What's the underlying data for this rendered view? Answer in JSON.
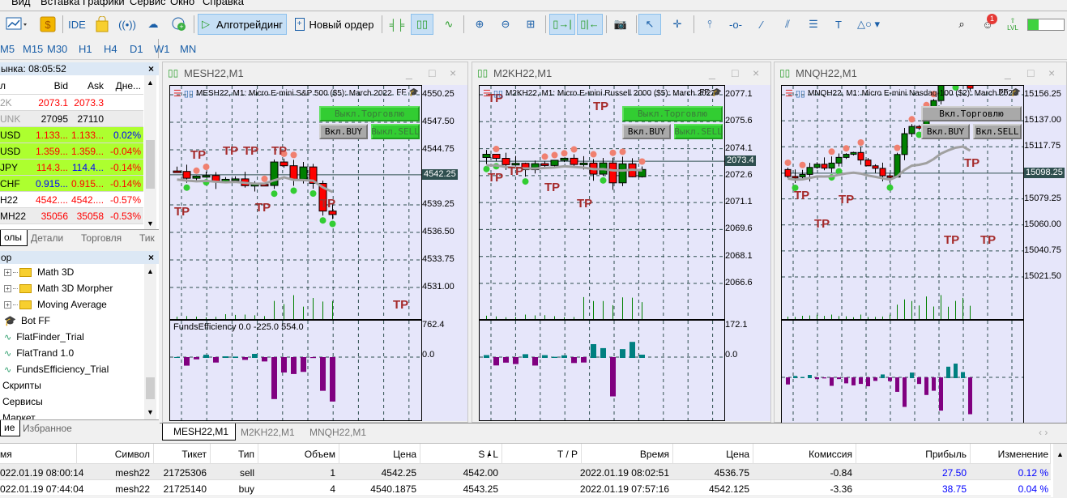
{
  "menu": [
    "Вид",
    "Вставка",
    "Графики",
    "Сервис",
    "Окно",
    "Справка"
  ],
  "toolbar": {
    "ide": "IDE",
    "algo": "Алготрейдинг",
    "new_order": "Новый ордер",
    "notif_count": "1",
    "lvl": "LVL"
  },
  "timeframes": [
    "M5",
    "M15",
    "M30",
    "H1",
    "H4",
    "D1",
    "W1",
    "MN"
  ],
  "market_watch": {
    "title": "ынка: 08:05:52",
    "columns": [
      "л",
      "Bid",
      "Ask",
      "Дне..."
    ],
    "rows": [
      {
        "sym": "2K",
        "bid": "2073.1",
        "ask": "2073.3",
        "chg": "",
        "bg": "#ffffff",
        "c": [
          "#999999",
          "#ff0000",
          "#ff0000",
          "#000000"
        ]
      },
      {
        "sym": "UNK",
        "bid": "27095",
        "ask": "27110",
        "chg": "",
        "bg": "#ececec",
        "c": [
          "#999999",
          "#000000",
          "#000000",
          "#000000"
        ]
      },
      {
        "sym": "USD",
        "bid": "1.133...",
        "ask": "1.133...",
        "chg": "0.02%",
        "bg": "#adff2f",
        "c": [
          "#000000",
          "#ff0000",
          "#ff0000",
          "#0000ff"
        ]
      },
      {
        "sym": "USD",
        "bid": "1.359...",
        "ask": "1.359...",
        "chg": "-0.04%",
        "bg": "#adff2f",
        "c": [
          "#000000",
          "#ff0000",
          "#ff0000",
          "#ff0000"
        ]
      },
      {
        "sym": "JPY",
        "bid": "114.3...",
        "ask": "114.4...",
        "chg": "-0.14%",
        "bg": "#adff2f",
        "c": [
          "#000000",
          "#ff0000",
          "#0000ff",
          "#ff0000"
        ]
      },
      {
        "sym": "CHF",
        "bid": "0.915...",
        "ask": "0.915...",
        "chg": "-0.14%",
        "bg": "#adff2f",
        "c": [
          "#000000",
          "#0000ff",
          "#ff0000",
          "#ff0000"
        ]
      },
      {
        "sym": "H22",
        "bid": "4542....",
        "ask": "4542....",
        "chg": "-0.57%",
        "bg": "#ffffff",
        "c": [
          "#000000",
          "#ff0000",
          "#ff0000",
          "#ff0000"
        ]
      },
      {
        "sym": "МН22",
        "bid": "35056",
        "ask": "35058",
        "chg": "-0.53%",
        "bg": "#ececec",
        "c": [
          "#000000",
          "#ff0000",
          "#ff0000",
          "#ff0000"
        ]
      }
    ],
    "tabs": [
      "олы",
      "Детали",
      "Торговля",
      "Тик"
    ]
  },
  "navigator": {
    "title": "ор",
    "items": [
      {
        "label": "Math 3D",
        "type": "folder"
      },
      {
        "label": "Math 3D Morpher",
        "type": "folder"
      },
      {
        "label": "Moving Average",
        "type": "folder"
      },
      {
        "label": "Bot FF",
        "type": "expert"
      },
      {
        "label": "FlatFinder_Trial",
        "type": "indicator"
      },
      {
        "label": "FlatTrand 1.0",
        "type": "indicator"
      },
      {
        "label": "FundsEfficiency_Trial",
        "type": "indicator"
      },
      {
        "label": "Скрипты",
        "type": "group"
      },
      {
        "label": "Сервисы",
        "type": "group"
      },
      {
        "label": "Маркет",
        "type": "group"
      }
    ],
    "tabs": [
      "ие",
      "Избранное"
    ]
  },
  "charts": [
    {
      "window_title": "MESH22,M1",
      "desc": "MESH22, M1: Micro E-mini S&P 500 ($5): March 2022",
      "ea": "FF",
      "ticks": [
        4550.25,
        4547.5,
        4544.75,
        4539.25,
        4536.5,
        4533.75,
        4531.0
      ],
      "tick_labels": [
        "4550.25",
        "4547.50",
        "4544.75",
        "4539.25",
        "4536.50",
        "4533.75",
        "4531.00"
      ],
      "current": "4542.25",
      "current_value": 4542.25,
      "buttons": [
        {
          "label": "Выкл.Торговлю",
          "state": "on"
        },
        {
          "label": "Вкл.BUY",
          "state": "off"
        },
        {
          "label": "Выкл.SELL",
          "state": "on"
        }
      ],
      "indicator": {
        "label": "FundsEfficiency 0.0 -225.0 554.0",
        "ticks": [
          "762.4",
          "0.0"
        ]
      },
      "tp": "TP",
      "seed": 7
    },
    {
      "window_title": "M2KH22,M1",
      "desc": "M2KH22, M1: Micro E-mini Russell 2000 ($5): March 2022",
      "ea": "FF",
      "ticks": [
        2077.1,
        2075.6,
        2074.1,
        2072.6,
        2071.1,
        2069.6,
        2068.1,
        2066.6
      ],
      "tick_labels": [
        "2077.1",
        "2075.6",
        "2074.1",
        "2072.6",
        "2071.1",
        "2069.6",
        "2068.1",
        "2066.6"
      ],
      "current": "2073.4",
      "current_value": 2073.4,
      "buttons": [
        {
          "label": "Выкл.Торговлю",
          "state": "on"
        },
        {
          "label": "Вкл.BUY",
          "state": "off"
        },
        {
          "label": "Выкл.SELL",
          "state": "on"
        }
      ],
      "indicator": {
        "label": "",
        "ticks": [
          "172.1",
          "0.0"
        ]
      },
      "tp": "TP",
      "seed": 13
    },
    {
      "window_title": "MNQH22,M1",
      "desc": "MNQH22, M1: Micro E-mini Nasdaq-100 ($2): March 2022",
      "ea": "FF",
      "ticks": [
        15156.25,
        15137.0,
        15117.75,
        15079.25,
        15060.0,
        15040.75,
        15021.5
      ],
      "tick_labels": [
        "15156.25",
        "15137.00",
        "15117.75",
        "15079.25",
        "15060.00",
        "15040.75",
        "15021.50"
      ],
      "current": "15098.25",
      "current_value": 15098.25,
      "buttons": [
        {
          "label": "Вкл.Торговлю",
          "state": "off"
        },
        {
          "label": "Вкл.BUY",
          "state": "off"
        },
        {
          "label": "Вкл.SELL",
          "state": "off"
        }
      ],
      "indicator": {
        "label": "",
        "ticks": []
      },
      "tp": "TP",
      "seed": 21
    }
  ],
  "chart_tabs": [
    "MESH22,M1",
    "M2KH22,M1",
    "MNQH22,M1"
  ],
  "trades": {
    "columns": [
      "мя",
      "Символ",
      "Тикет",
      "Тип",
      "Объем",
      "Цена",
      "S / L",
      "T / P",
      "Время",
      "Цена",
      "Комиссия",
      "Прибыль",
      "Изменение"
    ],
    "rows": [
      [
        "022.01.19 08:00:14",
        "mesh22",
        "21725306",
        "sell",
        "1",
        "4542.25",
        "4542.00",
        "",
        "2022.01.19 08:02:51",
        "4536.75",
        "-0.84",
        "27.50",
        "0.12 %"
      ],
      [
        "022.01.19 07:44:04",
        "mesh22",
        "21725140",
        "buy",
        "4",
        "4540.1875",
        "4543.25",
        "",
        "2022.01.19 07:57:16",
        "4542.125",
        "-3.36",
        "38.75",
        "0.04 %"
      ]
    ]
  },
  "colors": {
    "bull": "#008000",
    "bear": "#ff0000",
    "plot_bg": "#e6e6fa",
    "hist_pos": "#008080",
    "hist_neg": "#800080",
    "profit": "#0000ff"
  }
}
